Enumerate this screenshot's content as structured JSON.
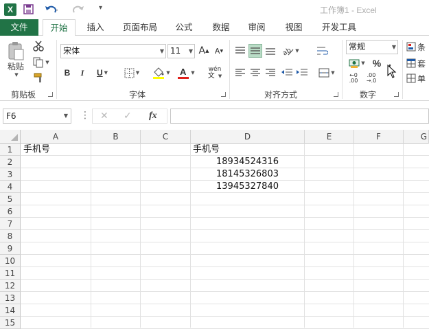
{
  "window": {
    "title": "工作簿1 - Excel"
  },
  "tabs": [
    {
      "label": "文件"
    },
    {
      "label": "开始"
    },
    {
      "label": "插入"
    },
    {
      "label": "页面布局"
    },
    {
      "label": "公式"
    },
    {
      "label": "数据"
    },
    {
      "label": "审阅"
    },
    {
      "label": "视图"
    },
    {
      "label": "开发工具"
    }
  ],
  "ribbon": {
    "clipboard": {
      "label": "剪贴板",
      "paste": "粘贴"
    },
    "font": {
      "label": "字体",
      "name": "宋体",
      "size": "11",
      "bold": "B",
      "italic": "I",
      "underline": "U",
      "phonetic": "wén"
    },
    "alignment": {
      "label": "对齐方式"
    },
    "number": {
      "label": "数字",
      "format": "常规",
      "percent": "%"
    },
    "styles": {
      "item1": "条",
      "item2": "套",
      "item3": "单"
    }
  },
  "formula_bar": {
    "name_box": "F6",
    "fx": "fx",
    "value": ""
  },
  "grid": {
    "columns": [
      "A",
      "B",
      "C",
      "D",
      "E",
      "F",
      "G"
    ],
    "rows": [
      "1",
      "2",
      "3",
      "4",
      "5",
      "6",
      "7",
      "8",
      "9",
      "10",
      "11",
      "12",
      "13",
      "14",
      "15"
    ],
    "cells": {
      "A1": "手机号",
      "D1": "手机号",
      "D2": "18934524316",
      "D3": "18145326803",
      "D4": "13945327840"
    }
  },
  "colors": {
    "excel_green": "#217346",
    "highlight_yellow": "#ffff00",
    "font_red": "#e0201b"
  }
}
